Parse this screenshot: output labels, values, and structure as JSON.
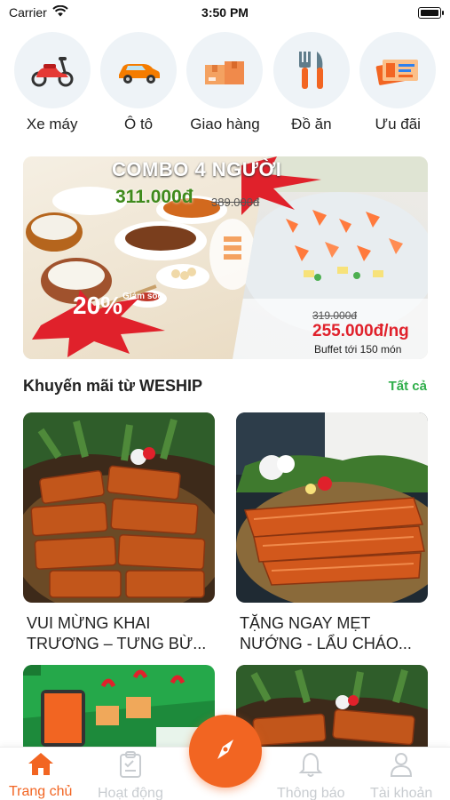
{
  "status_bar": {
    "carrier": "Carrier",
    "time": "3:50 PM"
  },
  "services": [
    {
      "label": "Xe máy",
      "icon": "scooter-icon"
    },
    {
      "label": "Ô tô",
      "icon": "car-icon"
    },
    {
      "label": "Giao hàng",
      "icon": "package-icon"
    },
    {
      "label": "Đồ ăn",
      "icon": "fork-knife-icon"
    },
    {
      "label": "Ưu đãi",
      "icon": "voucher-icon"
    }
  ],
  "banner": {
    "combo_title": "COMBO 4 NGƯỜI",
    "combo_price": "311.000đ",
    "combo_old_price": "389.000đ",
    "discount": "20%",
    "discount_note": "Giảm sốc",
    "buffet_old_price": "319.000đ",
    "buffet_price": "255.000đ/ng",
    "buffet_note": "Buffet tới 150 món"
  },
  "promotions": {
    "title": "Khuyến mãi từ WESHIP",
    "see_all": "Tất cả",
    "items": [
      {
        "line1": "VUI MỪNG KHAI",
        "line2": "TRƯƠNG – TƯNG BỪ..."
      },
      {
        "line1": "TẶNG NGAY MẸT",
        "line2": "NƯỚNG - LẨU CHÁO..."
      }
    ]
  },
  "bottom_nav": {
    "items": [
      {
        "label": "Trang chủ",
        "icon": "home-icon",
        "active": true
      },
      {
        "label": "Hoạt động",
        "icon": "clipboard-icon",
        "active": false
      },
      {
        "label": "Thông báo",
        "icon": "bell-icon",
        "active": false
      },
      {
        "label": "Tài khoản",
        "icon": "user-icon",
        "active": false
      }
    ],
    "center_icon": "compass-icon"
  },
  "colors": {
    "accent": "#f26522",
    "link_green": "#2fae4a",
    "price_red": "#e0212b",
    "price_green": "#3f8a1c"
  }
}
